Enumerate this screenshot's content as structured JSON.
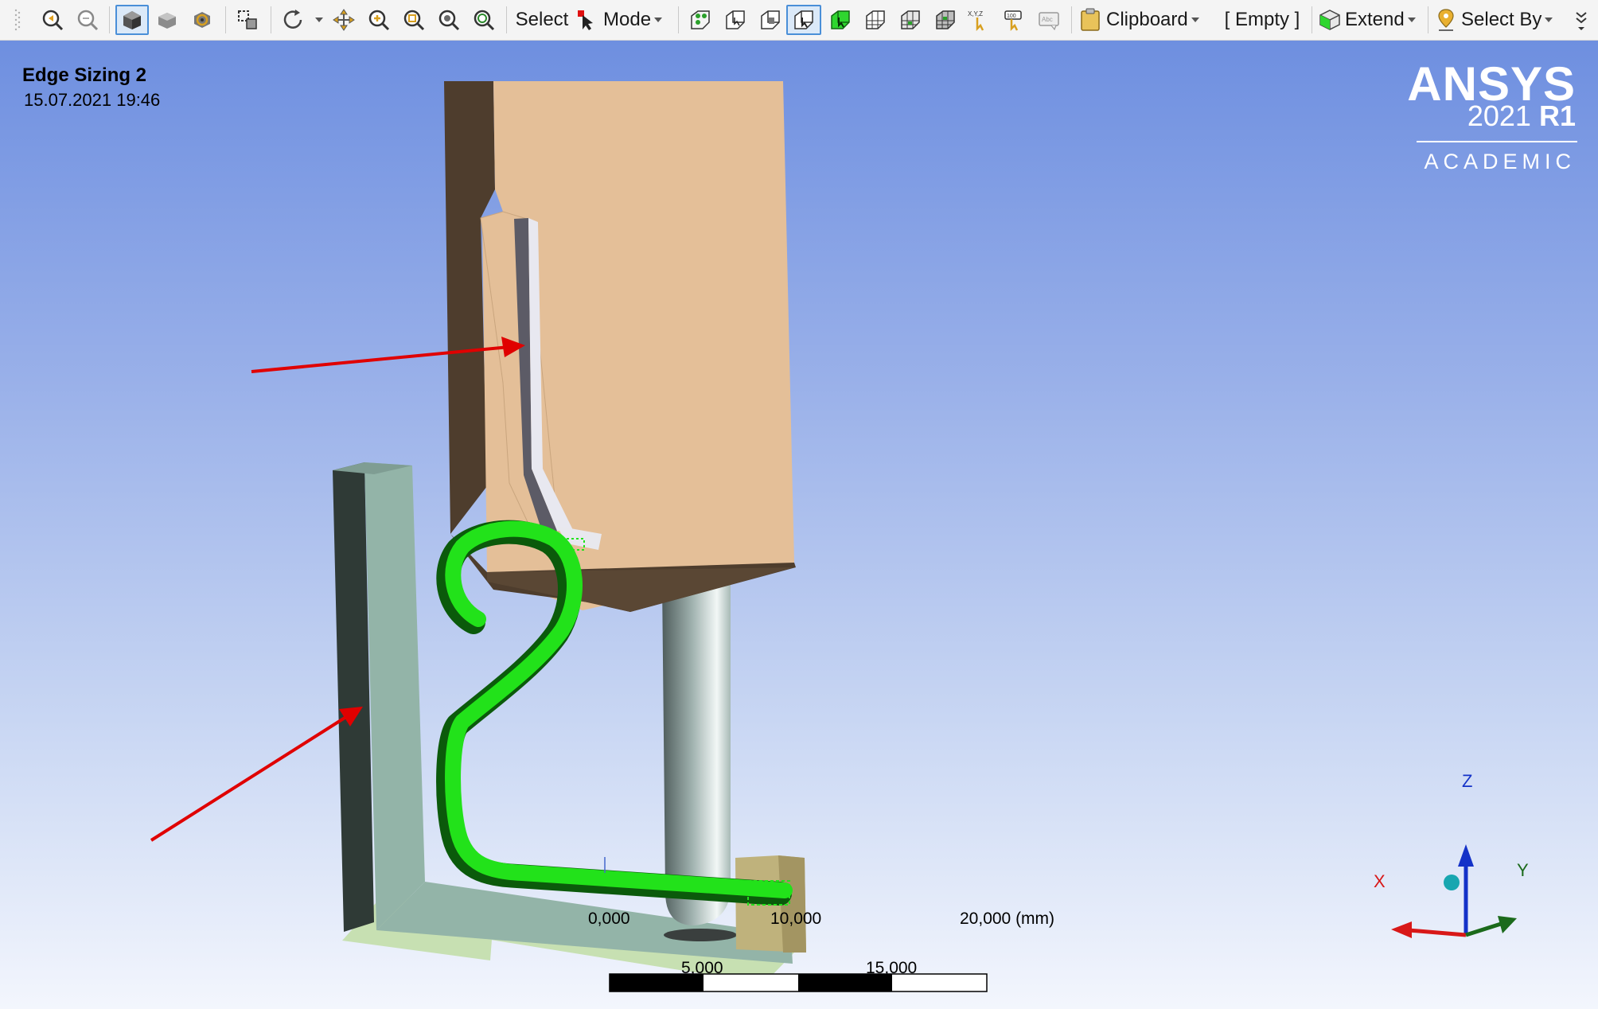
{
  "toolbar": {
    "select_label": "Select",
    "mode_label": "Mode",
    "clipboard_label": "Clipboard",
    "empty_label": "[ Empty ]",
    "extend_label": "Extend",
    "select_by_label": "Select By",
    "icons": [
      "zoom-previous-icon",
      "zoom-next-icon",
      "isometric-view-icon",
      "shaded-view-icon",
      "look-at-icon",
      "box-select-icon",
      "rotate-icon",
      "pan-icon",
      "zoom-icon",
      "box-zoom-icon",
      "zoom-to-fit-icon",
      "magnifier-icon",
      "select-mode-icon",
      "edge-select-icon",
      "face-select-icon",
      "body-select-icon",
      "vertex-select-icon",
      "node-select-icon",
      "element-select-icon",
      "element-face-select-icon",
      "coordinate-icon",
      "label-icon",
      "annotation-icon"
    ]
  },
  "viewport": {
    "title": "Edge Sizing 2",
    "timestamp": "15.07.2021 19:46"
  },
  "logo": {
    "brand": "ANSYS",
    "version": "2021",
    "release": "R1",
    "edition": "ACADEMIC"
  },
  "scale_bar": {
    "labels_top": [
      "0,000",
      "10,000",
      "20,000 (mm)"
    ],
    "labels_bottom": [
      "5,000",
      "15,000"
    ]
  },
  "triad": {
    "x_label": "X",
    "y_label": "Y",
    "z_label": "Z"
  },
  "colors": {
    "background_top": "#6e8fe0",
    "background_bottom": "#f3f6fd",
    "selected_edge": "#22e21a",
    "annotation_arrow": "#e00000",
    "block_face": "#e6bf96",
    "block_side": "#4f3e2e",
    "bracket": "#8fb3a5"
  }
}
